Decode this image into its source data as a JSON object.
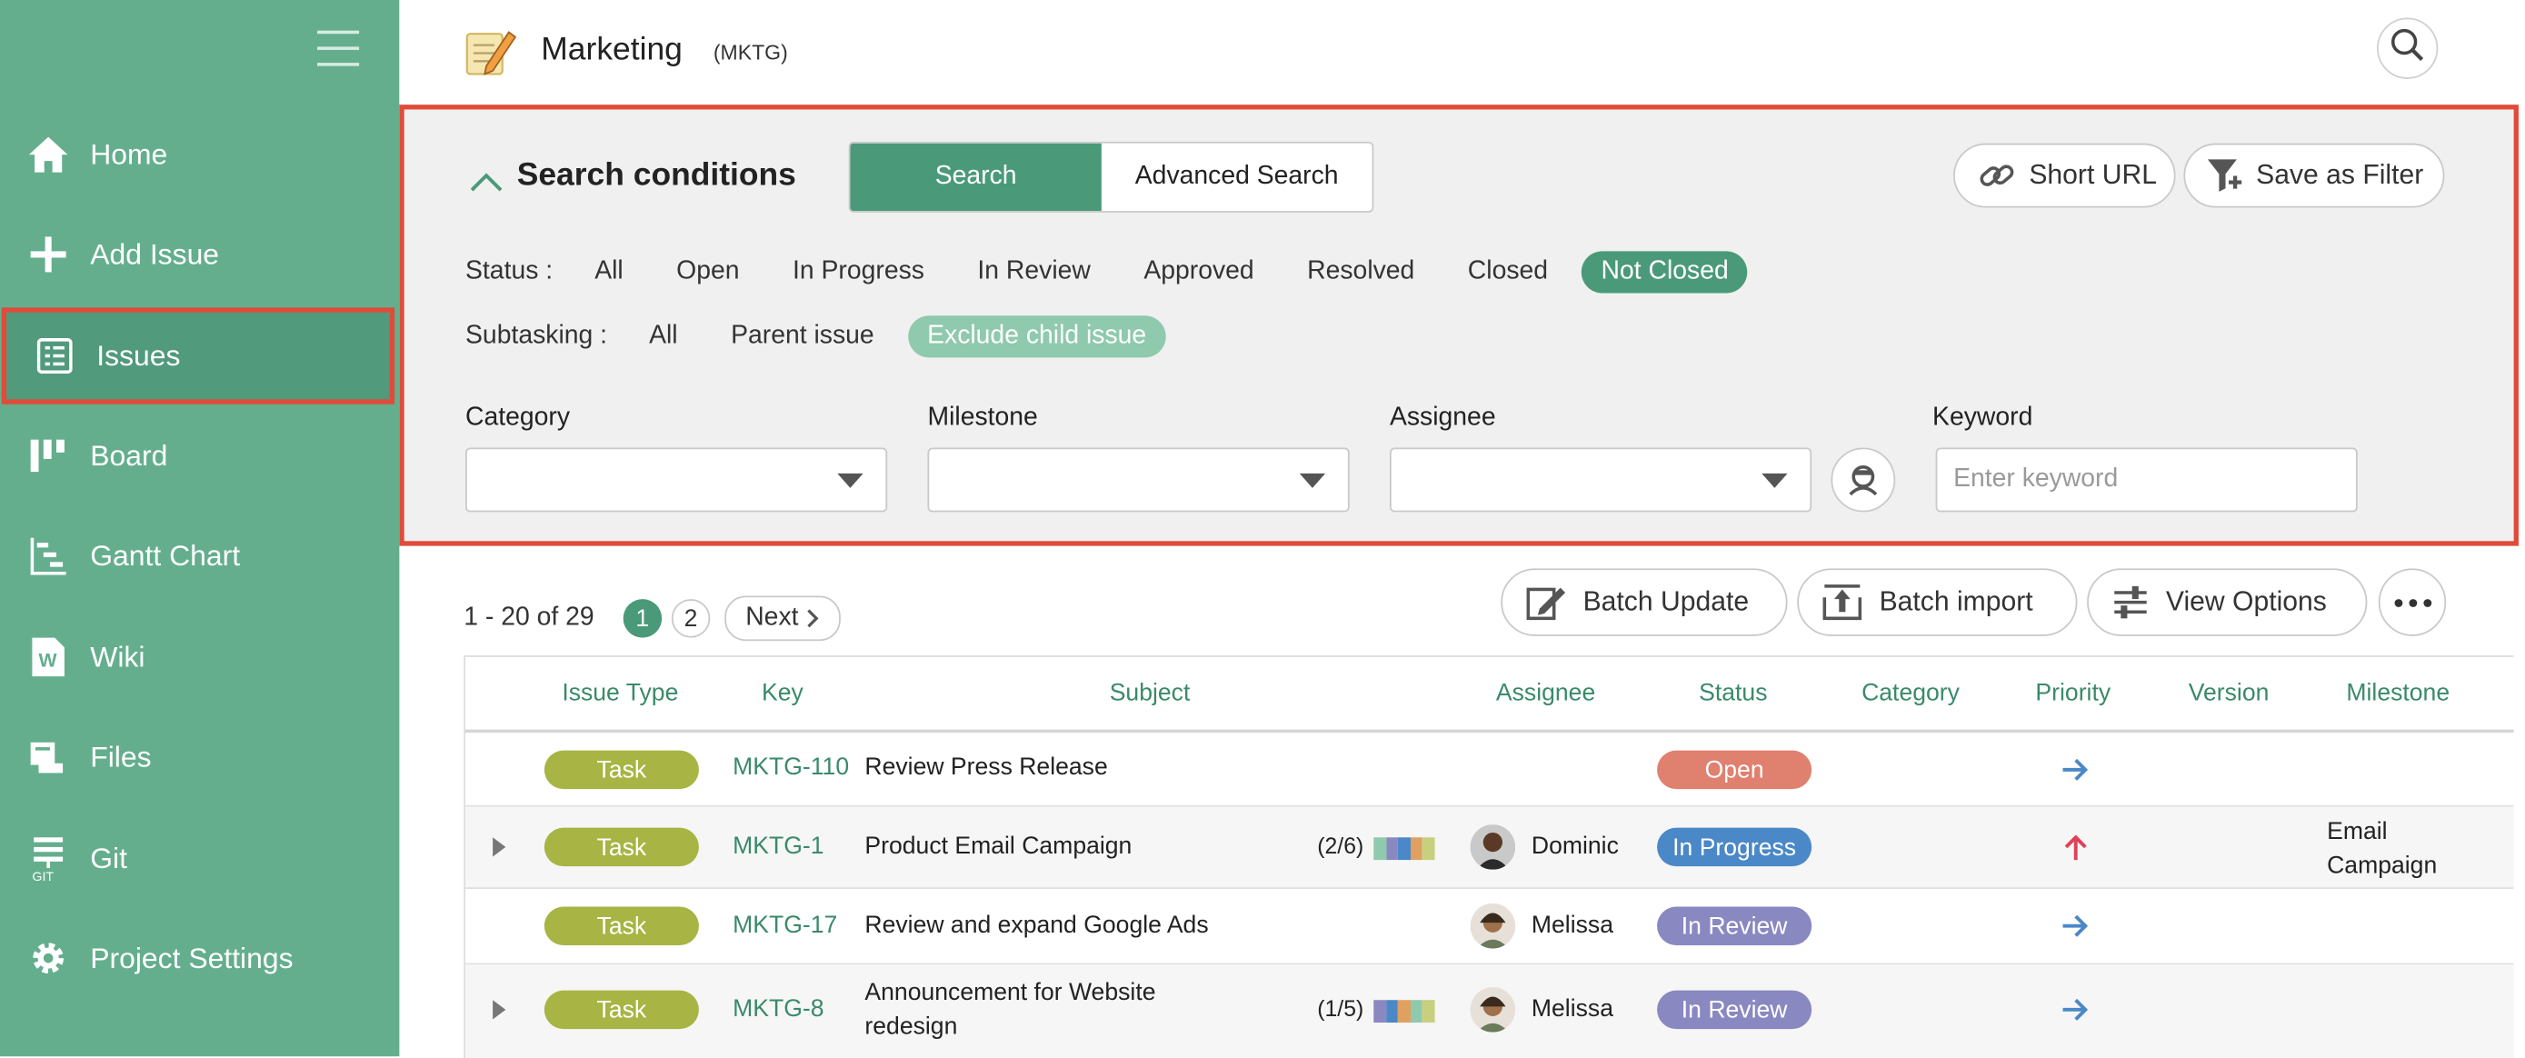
{
  "sidebar": {
    "items": [
      {
        "label": "Home",
        "icon": "home-icon"
      },
      {
        "label": "Add Issue",
        "icon": "plus-icon"
      },
      {
        "label": "Issues",
        "icon": "list-icon",
        "active": true
      },
      {
        "label": "Board",
        "icon": "board-icon"
      },
      {
        "label": "Gantt Chart",
        "icon": "gantt-icon"
      },
      {
        "label": "Wiki",
        "icon": "wiki-icon"
      },
      {
        "label": "Files",
        "icon": "files-icon"
      },
      {
        "label": "Git",
        "icon": "git-icon",
        "icon_text": "GIT"
      },
      {
        "label": "Project Settings",
        "icon": "gear-icon"
      }
    ]
  },
  "header": {
    "project_name": "Marketing",
    "project_key": "(MKTG)"
  },
  "search": {
    "title": "Search conditions",
    "tab_search": "Search",
    "tab_advanced": "Advanced Search",
    "short_url": "Short URL",
    "save_filter": "Save as Filter",
    "status_label": "Status :",
    "status_options": [
      "All",
      "Open",
      "In Progress",
      "In Review",
      "Approved",
      "Resolved",
      "Closed",
      "Not Closed"
    ],
    "status_selected": "Not Closed",
    "subtask_label": "Subtasking :",
    "subtask_options": [
      "All",
      "Parent issue",
      "Exclude child issue"
    ],
    "subtask_selected": "Exclude child issue",
    "category_label": "Category",
    "milestone_label": "Milestone",
    "assignee_label": "Assignee",
    "keyword_label": "Keyword",
    "keyword_placeholder": "Enter keyword",
    "keyword_value": ""
  },
  "list": {
    "range": "1 - 20 of 29",
    "pages": [
      "1",
      "2"
    ],
    "current_page": "1",
    "next": "Next",
    "batch_update": "Batch Update",
    "batch_import": "Batch import",
    "view_options": "View Options"
  },
  "table": {
    "columns": [
      "Issue Type",
      "Key",
      "Subject",
      "Assignee",
      "Status",
      "Category",
      "Priority",
      "Version",
      "Milestone"
    ],
    "rows": [
      {
        "type": "Task",
        "key": "MKTG-110",
        "subject": "Review Press Release",
        "subtasks": "",
        "assignee": "",
        "status": "Open",
        "priority": "normal",
        "milestone": "",
        "expandable": false
      },
      {
        "type": "Task",
        "key": "MKTG-1",
        "subject": "Product Email Campaign",
        "subtasks": "(2/6)",
        "assignee": "Dominic",
        "status": "In Progress",
        "priority": "high",
        "milestone": "Email Campaign",
        "expandable": true
      },
      {
        "type": "Task",
        "key": "MKTG-17",
        "subject": "Review and expand Google Ads",
        "subtasks": "",
        "assignee": "Melissa",
        "status": "In Review",
        "priority": "normal",
        "milestone": "",
        "expandable": false
      },
      {
        "type": "Task",
        "key": "MKTG-8",
        "subject": "Announcement for Website redesign",
        "subtasks": "(1/5)",
        "assignee": "Melissa",
        "status": "In Review",
        "priority": "normal",
        "milestone": "",
        "expandable": true
      }
    ]
  },
  "colors": {
    "sidebar": "#64ae8e",
    "accent": "#4a9a7a",
    "highlight_border": "#e04b3a",
    "task_badge": "#a8b443",
    "status_open": "#e0806f",
    "status_in_progress": "#4a88c7",
    "status_in_review": "#8a88c0",
    "priority_normal": "#4a88c7",
    "priority_high": "#e0405a"
  }
}
